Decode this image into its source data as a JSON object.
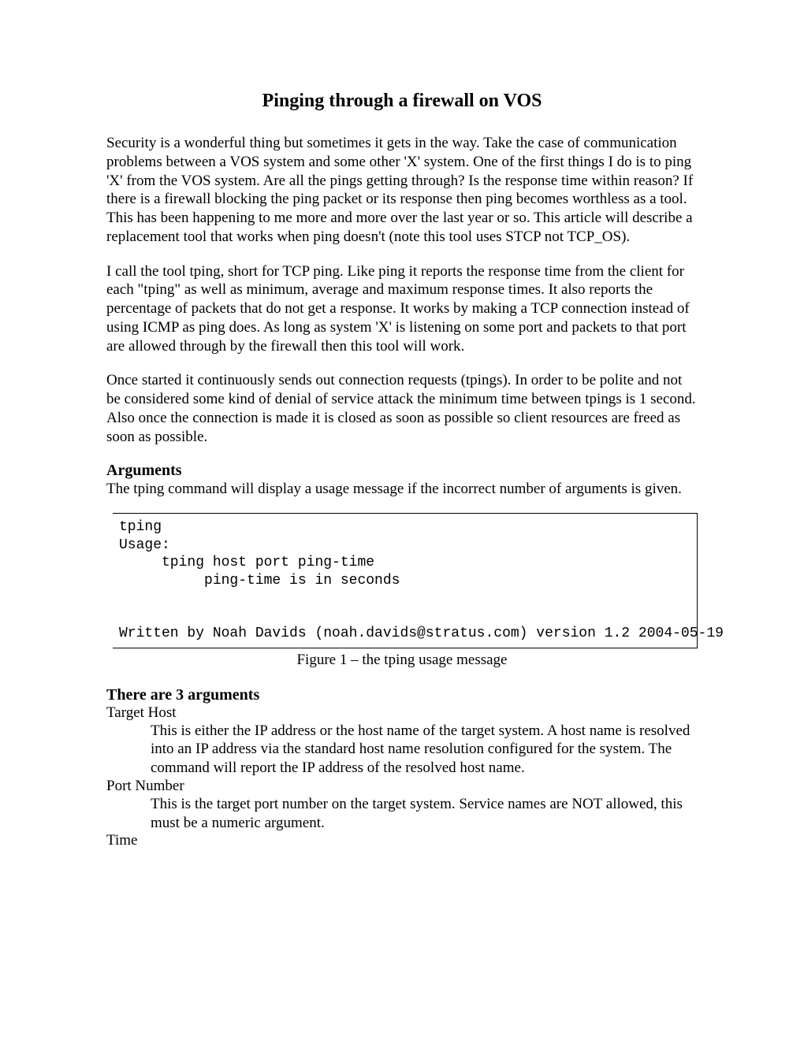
{
  "title": "Pinging through a firewall on VOS",
  "para1": "Security is a wonderful thing but sometimes it gets in the way. Take the case of communication problems between a VOS system and some other 'X' system. One of the first things I do is to ping 'X' from the VOS system. Are all the pings getting through? Is the response time within reason? If there is a firewall blocking the ping packet or its response then ping becomes worthless as a tool. This has been happening to me more and more over the last year or so. This article will describe a replacement tool that works when ping doesn't (note this tool uses STCP not TCP_OS).",
  "para2": "I call the tool tping, short for TCP ping. Like ping it reports the response time from the client for each \"tping\" as well as minimum, average and maximum response times. It also reports the percentage of packets that do not get a response. It works by making a TCP connection instead of using ICMP as ping does. As long as system 'X' is listening on some port and packets to that port are allowed through by the firewall then this tool will work.",
  "para3": "Once started it continuously sends out connection requests (tpings). In order to be polite and not be considered some kind of denial of service attack the minimum time between tpings is 1 second. Also once the connection is made it is closed as soon as possible so client resources are freed as soon as possible.",
  "sections": {
    "arguments_title": "Arguments",
    "arguments_intro": "The tping command will display a usage message if the incorrect number of arguments is given.",
    "code": "tping\nUsage:\n     tping host port ping-time\n          ping-time is in seconds\n\n\nWritten by Noah Davids (noah.davids@stratus.com) version 1.2 2004-05-19",
    "caption": "Figure 1 – the tping usage message",
    "three_args_title": "There are 3 arguments",
    "args": [
      {
        "name": "Target Host",
        "desc": "This is either the IP address or the host name of the target system. A host name is resolved into an IP address via the standard host name resolution configured for the system. The command will report the IP address of the resolved host name."
      },
      {
        "name": "Port Number",
        "desc": "This is the target port number on the target system. Service names are NOT allowed, this must be a numeric argument."
      },
      {
        "name": "Time",
        "desc": ""
      }
    ]
  }
}
